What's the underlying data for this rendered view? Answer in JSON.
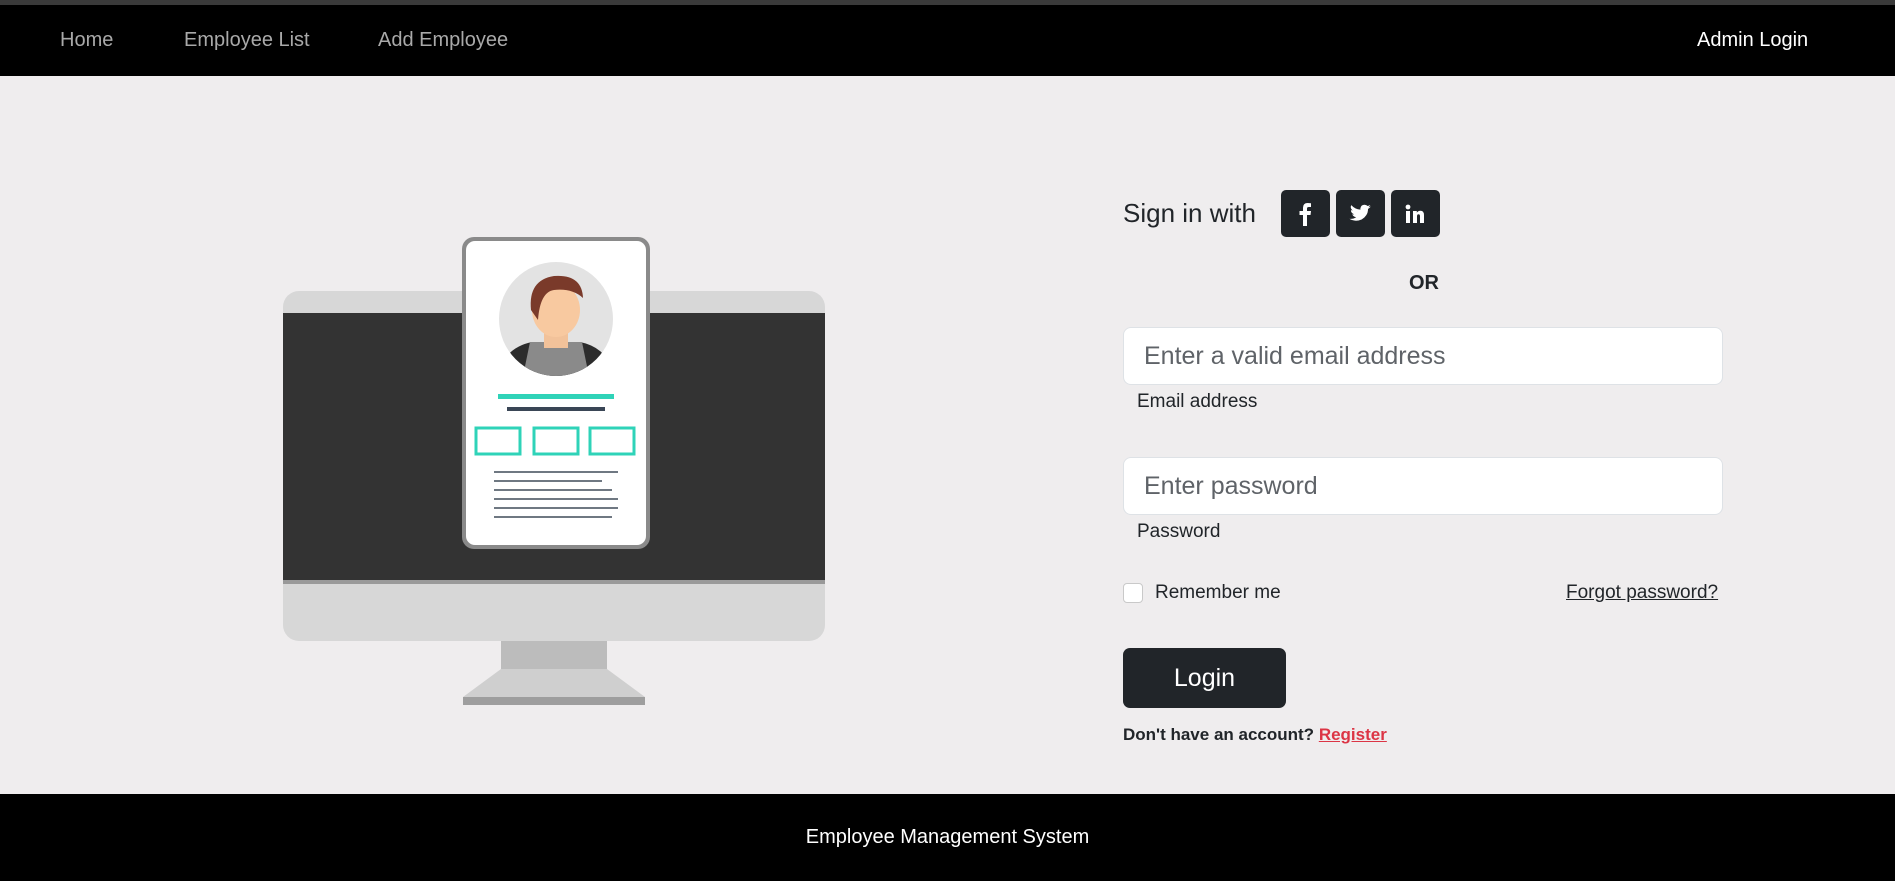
{
  "nav": {
    "links": [
      "Home",
      "Employee List",
      "Add Employee"
    ],
    "admin_login": "Admin Login"
  },
  "login": {
    "signin_label": "Sign in with",
    "social": [
      "facebook-icon",
      "twitter-icon",
      "linkedin-icon"
    ],
    "or_label": "OR",
    "email_placeholder": "Enter a valid email address",
    "email_label": "Email address",
    "password_placeholder": "Enter password",
    "password_label": "Password",
    "remember_label": "Remember me",
    "forgot_label": "Forgot password?",
    "login_button": "Login",
    "no_account": "Don't have an account?",
    "register_link": "Register"
  },
  "footer": {
    "text": "Employee Management System"
  },
  "colors": {
    "nav_bg": "#000000",
    "page_bg": "#efedee",
    "button_dark": "#212529",
    "accent_teal": "#2fd3b8",
    "register_red": "#dc3545"
  }
}
